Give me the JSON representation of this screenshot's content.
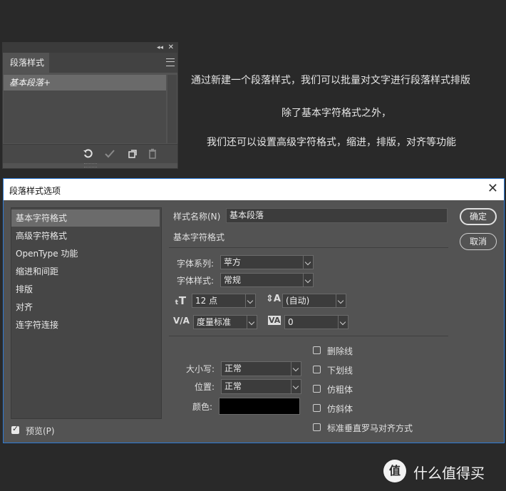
{
  "panel": {
    "tab_label": "段落样式",
    "items": [
      "基本段落+"
    ],
    "collapse_glyph": "◂◂",
    "close_glyph": "✕",
    "bottom_icons": [
      "clear-overrides-icon",
      "redefine-style-icon",
      "new-style-icon",
      "delete-icon"
    ]
  },
  "description": {
    "line1": "通过新建一个段落样式，我们可以批量对文字进行段落样式排版",
    "line2": "除了基本字符格式之外，",
    "line3": "我们还可以设置高级字符格式，缩进，排版，对齐等功能"
  },
  "dialog": {
    "title": "段落样式选项",
    "categories": [
      "基本字符格式",
      "高级字符格式",
      "OpenType 功能",
      "缩进和间距",
      "排版",
      "对齐",
      "连字符连接"
    ],
    "selected_category": "基本字符格式",
    "preview_label": "预览(P)",
    "preview_checked": true,
    "style_name_label": "样式名称(N)",
    "style_name_value": "基本段落",
    "section_title": "基本字符格式",
    "font_family_label": "字体系列:",
    "font_family_value": "苹方",
    "font_style_label": "字体样式:",
    "font_style_value": "常规",
    "font_size_value": "12 点",
    "leading_value": "(自动)",
    "kerning_value": "度量标准",
    "tracking_value": "0",
    "case_label": "大小写:",
    "case_value": "正常",
    "position_label": "位置:",
    "position_value": "正常",
    "color_label": "颜色:",
    "color_value": "#000000",
    "checkboxes": [
      "删除线",
      "下划线",
      "仿粗体",
      "仿斜体",
      "标准垂直罗马对齐方式"
    ],
    "ok_label": "确定",
    "cancel_label": "取消"
  },
  "watermark": {
    "logo_glyph": "值",
    "text": "什么值得买"
  }
}
